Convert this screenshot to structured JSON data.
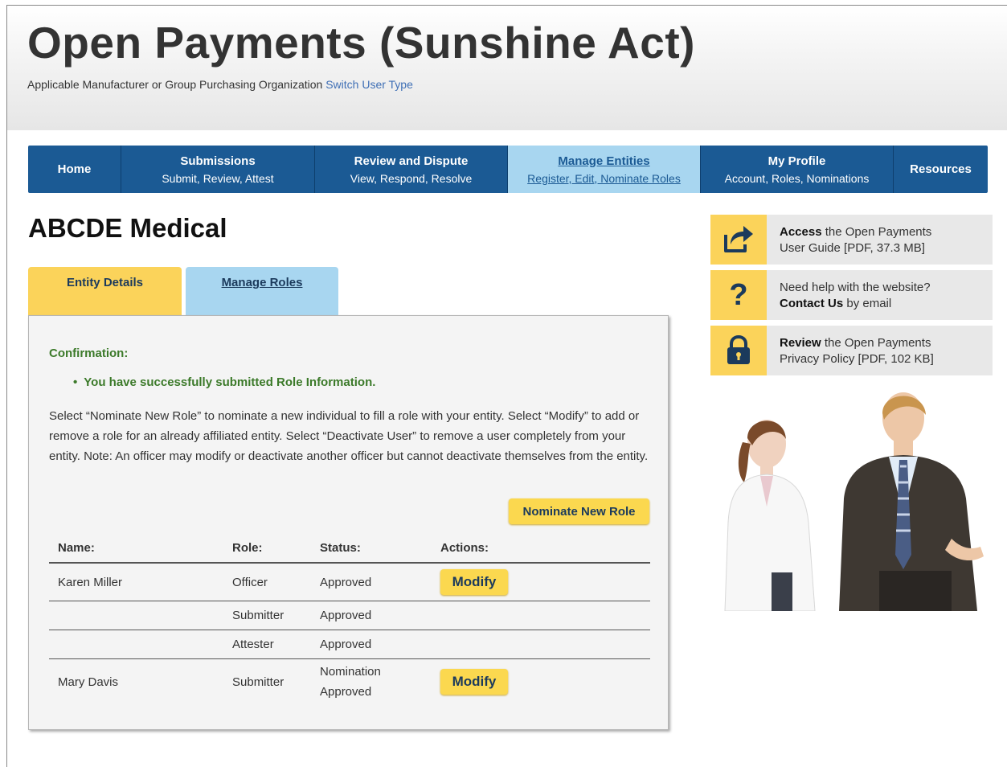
{
  "header": {
    "title": "Open Payments (Sunshine Act)",
    "user_type": "Applicable Manufacturer or Group Purchasing Organization",
    "switch_link": "Switch User Type"
  },
  "nav": [
    {
      "label": "Home",
      "sub": "",
      "active": false
    },
    {
      "label": "Submissions",
      "sub": "Submit, Review, Attest",
      "active": false
    },
    {
      "label": "Review and Dispute",
      "sub": "View, Respond, Resolve",
      "active": false
    },
    {
      "label": "Manage Entities",
      "sub": "Register, Edit, Nominate Roles",
      "active": true
    },
    {
      "label": "My Profile",
      "sub": "Account, Roles, Nominations",
      "active": false
    },
    {
      "label": "Resources",
      "sub": "",
      "active": false
    }
  ],
  "entity": {
    "name": "ABCDE Medical"
  },
  "tabs": {
    "entity_details": "Entity Details",
    "manage_roles": "Manage Roles"
  },
  "confirmation": {
    "title": "Confirmation:",
    "message": "You have successfully submitted Role Information."
  },
  "instructions": "Select “Nominate New Role” to nominate a new individual to fill a role with your entity. Select “Modify” to add or remove a role for an already affiliated entity. Select “Deactivate User” to remove a user completely from your entity. Note: An officer may modify or deactivate another officer but cannot deactivate themselves from the entity.",
  "buttons": {
    "nominate": "Nominate New Role",
    "modify": "Modify"
  },
  "table": {
    "headers": [
      "Name:",
      "Role:",
      "Status:",
      "Actions:"
    ],
    "rows": [
      {
        "name": "Karen Miller",
        "role": "Officer",
        "status": "Approved",
        "action": "Modify"
      },
      {
        "name": "",
        "role": "Submitter",
        "status": "Approved",
        "action": ""
      },
      {
        "name": "",
        "role": "Attester",
        "status": "Approved",
        "action": ""
      },
      {
        "name": "Mary Davis",
        "role": "Submitter",
        "status_line1": "Nomination",
        "status_line2": "Approved",
        "action": "Modify"
      }
    ]
  },
  "sidebar": [
    {
      "icon": "share-arrow-icon",
      "bold": "Access",
      "text1": " the Open Payments",
      "text2": "User Guide [PDF, 37.3 MB]"
    },
    {
      "icon": "question-mark-icon",
      "text1": "Need help with the website?",
      "bold": "Contact Us",
      "text2": " by email"
    },
    {
      "icon": "lock-icon",
      "bold": "Review",
      "text1": " the Open Payments",
      "text2": "Privacy Policy [PDF, 102 KB]"
    }
  ],
  "colors": {
    "nav_bg": "#1b5a94",
    "nav_active": "#a8d6f0",
    "accent_yellow": "#fbd35a",
    "confirm_green": "#3c7a2a",
    "link_blue": "#3f6fb5"
  }
}
